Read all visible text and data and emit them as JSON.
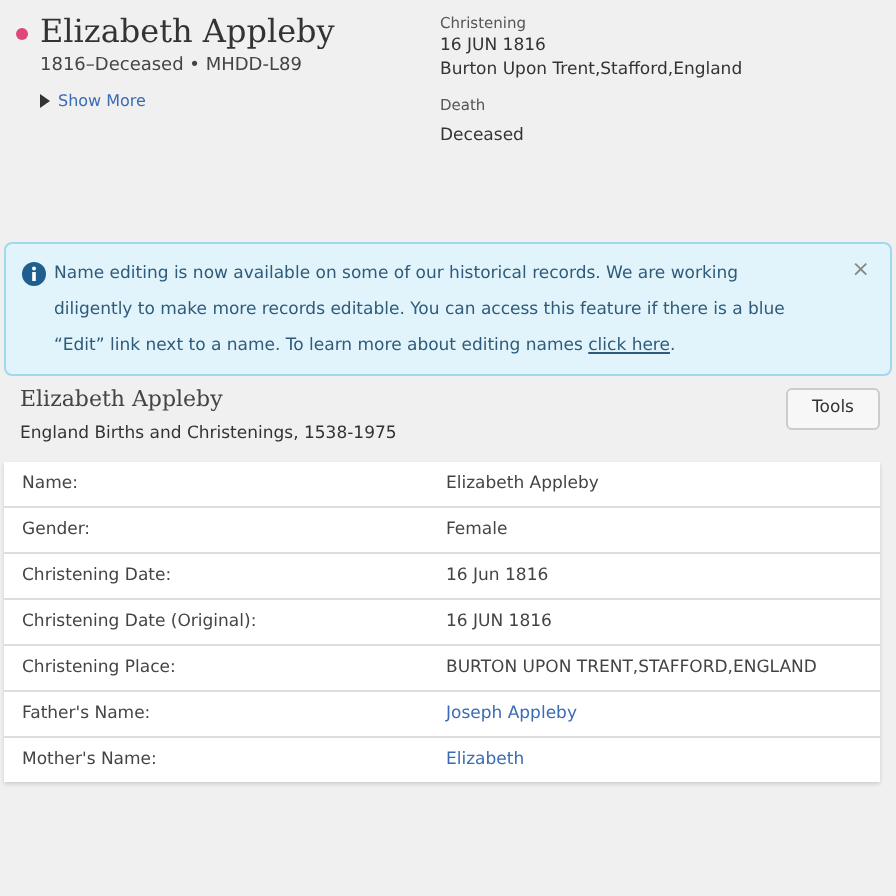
{
  "person": {
    "name": "Elizabeth Appleby",
    "summary": "1816–Deceased • MHDD-L89",
    "show_more": "Show More",
    "expanded": false
  },
  "events": [
    {
      "label": "Christening",
      "lines": [
        "16 JUN 1816",
        "Burton Upon Trent,Stafford,England"
      ]
    },
    {
      "label": "Death",
      "lines": [
        "Deceased"
      ]
    }
  ],
  "alert": {
    "text": "Name editing is now available on some of our historical records. We are working diligently to make more records editable. You can access this feature if there is a blue “Edit” link next to a name. To learn more about editing names ",
    "link": "click here",
    "after": ".",
    "close": "×"
  },
  "record": {
    "title": "Elizabeth Appleby",
    "collection": "England Births and Christenings, 1538-1975",
    "tools": "Tools"
  },
  "table": {
    "rows": [
      {
        "label": "Name:",
        "value": "Elizabeth Appleby",
        "kind": "text"
      },
      {
        "label": "Gender:",
        "value": "Female",
        "kind": "text"
      },
      {
        "label": "Christening Date:",
        "value": "16 Jun 1816",
        "kind": "text"
      },
      {
        "label": "Christening Date (Original):",
        "value": "16 JUN 1816",
        "kind": "text"
      },
      {
        "label": "Christening Place:",
        "value": "BURTON UPON TRENT,STAFFORD,ENGLAND",
        "kind": "text"
      },
      {
        "label": "Father's Name:",
        "value": "Joseph Appleby",
        "kind": "link"
      },
      {
        "label": "Mother's Name:",
        "value": "Elizabeth",
        "kind": "link"
      }
    ]
  }
}
